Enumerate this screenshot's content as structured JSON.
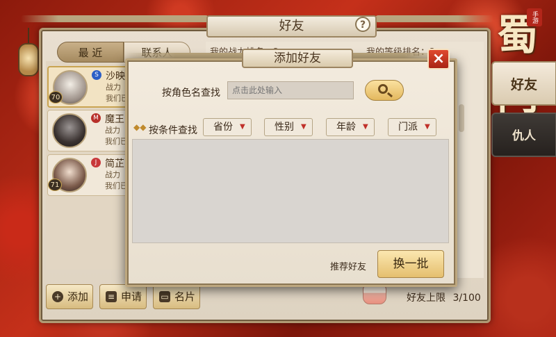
{
  "window": {
    "title": "好友",
    "help_symbol": "?"
  },
  "logo": {
    "text": "蜀门",
    "seal": "手游"
  },
  "side_tabs": [
    {
      "label": "好友"
    },
    {
      "label": "仇人"
    }
  ],
  "list_tabs": [
    {
      "label": "最 近"
    },
    {
      "label": "联系人"
    }
  ],
  "friends": [
    {
      "name": "沙映",
      "power": "战力",
      "message": "我们已",
      "level": "70",
      "school_color": "#2c5fc6",
      "school_symbol": "S"
    },
    {
      "name": "魔王",
      "power": "战力",
      "message": "我们已",
      "level": "",
      "school_color": "#b8302a",
      "school_symbol": "M"
    },
    {
      "name": "简芷",
      "power": "战力",
      "message": "我们已",
      "level": "71",
      "school_color": "#c8383a",
      "school_symbol": "J"
    }
  ],
  "stats": {
    "power_rank": "我的战力排名：2",
    "level_rank": "我的等级排名：2"
  },
  "bottom_buttons": [
    {
      "label": "添加",
      "icon": "plus-icon"
    },
    {
      "label": "申请",
      "icon": "document-icon"
    },
    {
      "label": "名片",
      "icon": "card-icon"
    }
  ],
  "friend_limit": {
    "label": "好友上限",
    "value": "3/100"
  },
  "dialog": {
    "title": "添加好友",
    "close_symbol": "×",
    "search_by_name_label": "按角色名查找",
    "name_input_placeholder": "点击此处输入",
    "search_by_condition_label": "按条件查找",
    "filters": [
      {
        "label": "省份"
      },
      {
        "label": "性别"
      },
      {
        "label": "年龄"
      },
      {
        "label": "门派"
      }
    ],
    "recommend_label": "推荐好友",
    "refresh_label": "换一批"
  },
  "colors": {
    "accent_gold": "#e3b85e",
    "close_red": "#c8301e",
    "parchment": "#ede3d4"
  }
}
